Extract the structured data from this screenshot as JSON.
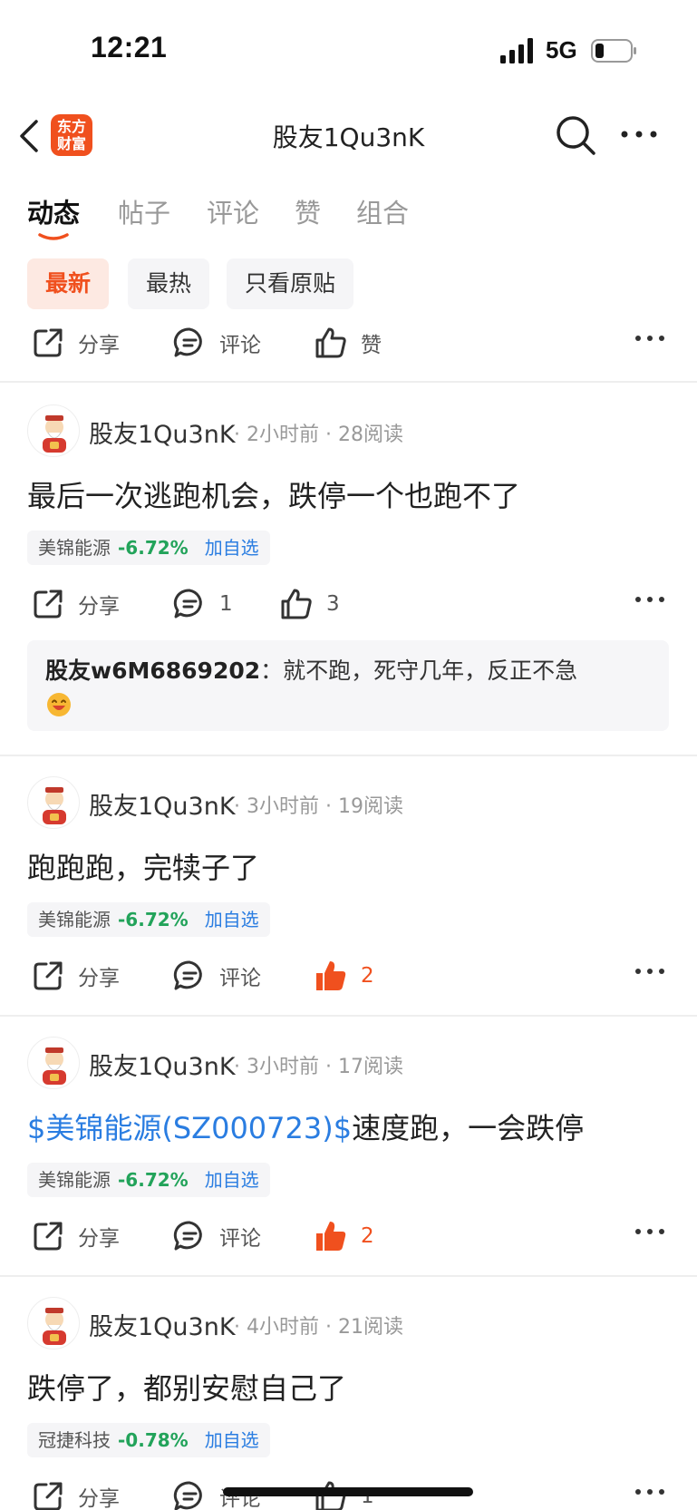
{
  "status_bar": {
    "time": "12:21",
    "network": "5G"
  },
  "nav": {
    "logo_line1": "东方",
    "logo_line2": "财富",
    "title": "股友1Qu3nK"
  },
  "tabs": [
    "动态",
    "帖子",
    "评论",
    "赞",
    "组合"
  ],
  "filters": [
    "最新",
    "最热",
    "只看原贴"
  ],
  "top_actions": {
    "share": "分享",
    "comment": "评论",
    "like": "赞"
  },
  "posts": [
    {
      "author": "股友1Qu3nK",
      "meta": "· 2小时前 · 28阅读",
      "link": "",
      "text": "最后一次逃跑机会，跌停一个也跑不了",
      "stock": {
        "name": "美锦能源",
        "change": "-6.72%",
        "add": "加自选"
      },
      "actions": {
        "share": "分享",
        "comment": "1",
        "like": "3"
      },
      "comment": {
        "user": "股友w6M6869202",
        "sep": "：",
        "text": "就不跑，死守几年，反正不急"
      }
    },
    {
      "author": "股友1Qu3nK",
      "meta": "· 3小时前 · 19阅读",
      "link": "",
      "text": "跑跑跑，完犊子了",
      "stock": {
        "name": "美锦能源",
        "change": "-6.72%",
        "add": "加自选"
      },
      "actions": {
        "share": "分享",
        "comment": "评论",
        "like": "2"
      }
    },
    {
      "author": "股友1Qu3nK",
      "meta": "· 3小时前 · 17阅读",
      "link": "$美锦能源(SZ000723)$",
      "text": "速度跑，一会跌停",
      "stock": {
        "name": "美锦能源",
        "change": "-6.72%",
        "add": "加自选"
      },
      "actions": {
        "share": "分享",
        "comment": "评论",
        "like": "2"
      }
    },
    {
      "author": "股友1Qu3nK",
      "meta": "· 4小时前 · 21阅读",
      "link": "",
      "text": "跌停了，都别安慰自己了",
      "stock": {
        "name": "冠捷科技",
        "change": "-0.78%",
        "add": "加自选"
      },
      "actions": {
        "share": "分享",
        "comment": "评论",
        "like": "1"
      }
    }
  ],
  "colors": {
    "accent": "#f0501e",
    "link": "#2a7de1",
    "down": "#22a35a"
  }
}
